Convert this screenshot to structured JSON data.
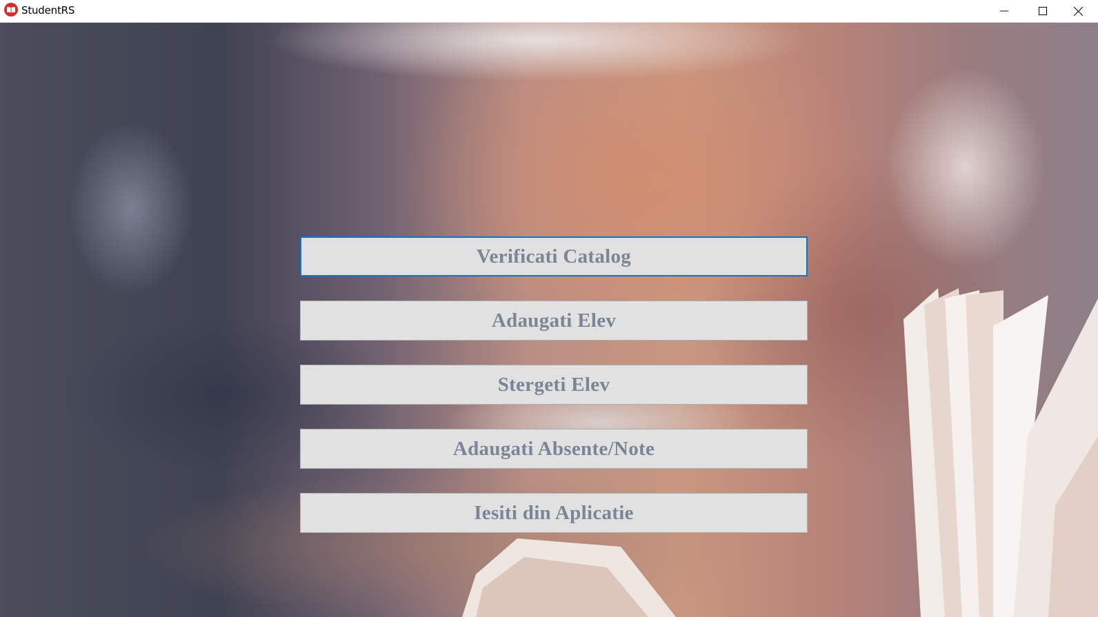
{
  "window": {
    "title": "StudentRS",
    "app_icon": "book-app-icon",
    "controls": {
      "minimize_icon": "minimize-icon",
      "maximize_icon": "maximize-icon",
      "close_icon": "close-icon"
    }
  },
  "menu": {
    "buttons": [
      {
        "label": "Verificati Catalog",
        "focused": true
      },
      {
        "label": "Adaugati Elev",
        "focused": false
      },
      {
        "label": "Stergeti Elev",
        "focused": false
      },
      {
        "label": "Adaugati Absente/Note",
        "focused": false
      },
      {
        "label": "Iesiti din Aplicatie",
        "focused": false
      }
    ]
  },
  "colors": {
    "button_background": "#e1e1e1",
    "button_text": "#7a8595",
    "focus_border": "#0078d7",
    "app_icon_red": "#d62b2b"
  }
}
